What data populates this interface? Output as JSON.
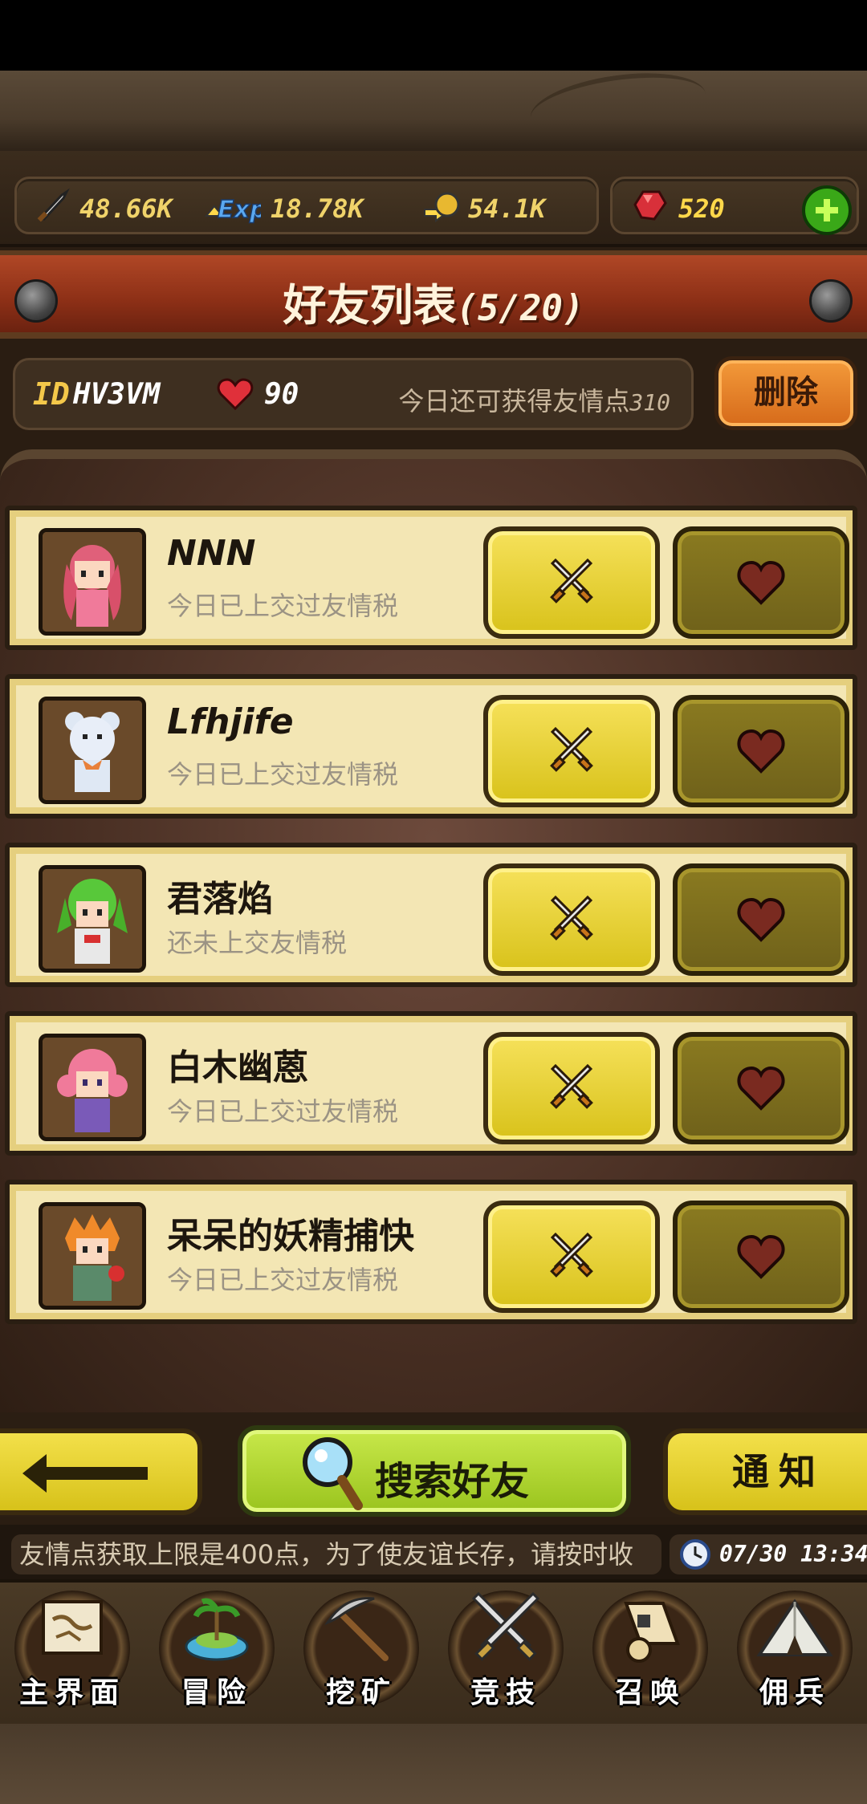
{
  "resources": {
    "attack": "48.66K",
    "exp": "18.78K",
    "gold": "54.1K",
    "gems": "520"
  },
  "header": {
    "title": "好友列表",
    "count": "(5/20)"
  },
  "info": {
    "id_label": "ID",
    "id_value": "HV3VM",
    "hearts": "90",
    "points_text": "今日还可获得友情点",
    "points_value": "310",
    "delete_label": "删除"
  },
  "friends": [
    {
      "name": "NNN",
      "status": "今日已上交过友情税"
    },
    {
      "name": "Lfhjife",
      "status": "今日已上交过友情税"
    },
    {
      "name": "君落焰",
      "status": "还未上交友情税"
    },
    {
      "name": "白木幽蒽",
      "status": "今日已上交过友情税"
    },
    {
      "name": "呆呆的妖精捕快",
      "status": "今日已上交过友情税"
    }
  ],
  "buttons": {
    "search_label": "搜索好友",
    "notice_label": "通知"
  },
  "ticker": {
    "text": "友情点获取上限是400点，为了使友谊长存，请按时收",
    "time": "07/30 13:34"
  },
  "nav": [
    {
      "label": "主界面",
      "icon": "map-scroll-icon"
    },
    {
      "label": "冒险",
      "icon": "island-icon"
    },
    {
      "label": "挖矿",
      "icon": "pickaxe-icon"
    },
    {
      "label": "竞技",
      "icon": "crossed-swords-icon"
    },
    {
      "label": "召唤",
      "icon": "summon-scroll-icon"
    },
    {
      "label": "佣兵",
      "icon": "tent-icon"
    }
  ]
}
